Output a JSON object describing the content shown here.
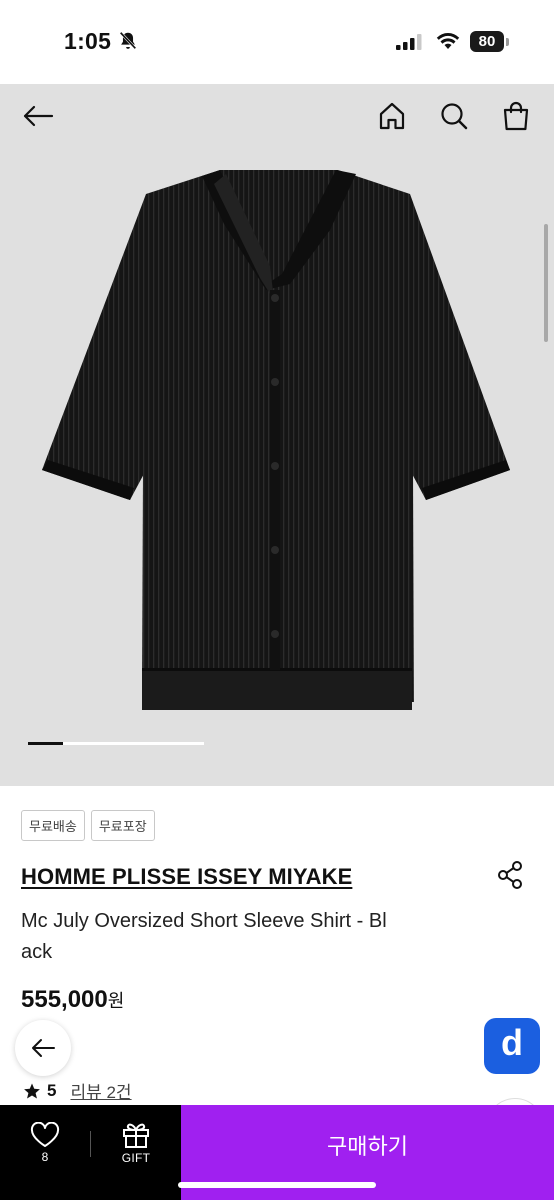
{
  "status_bar": {
    "time": "1:05",
    "battery": "80",
    "icons": [
      "bell-slash-icon",
      "signal-icon",
      "wifi-icon",
      "battery-icon"
    ]
  },
  "header": {
    "icons": [
      "back-arrow-icon",
      "home-icon",
      "search-icon",
      "shopping-bag-icon"
    ]
  },
  "gallery": {
    "image": "black pleated short sleeve shirt",
    "pager_progress": 0.2
  },
  "badges": [
    "무료배송",
    "무료포장"
  ],
  "product": {
    "brand": "HOMME PLISSE ISSEY MIYAKE",
    "name": "Mc July Oversized Short Sleeve Shirt - Black",
    "name_line1": "Mc July Oversized Short Sleeve Shirt - Bl",
    "name_line2": "ack",
    "price": "555,000",
    "currency": "원"
  },
  "rating": {
    "score": "5",
    "reviews": "리뷰 2건"
  },
  "bottom_bar": {
    "wish_count": "8",
    "gift_label": "GIFT",
    "buy_label": "구매하기"
  },
  "colors": {
    "accent": "#a020f0",
    "d_button": "#1b5fe0",
    "hero_bg": "#e0e0e0"
  }
}
